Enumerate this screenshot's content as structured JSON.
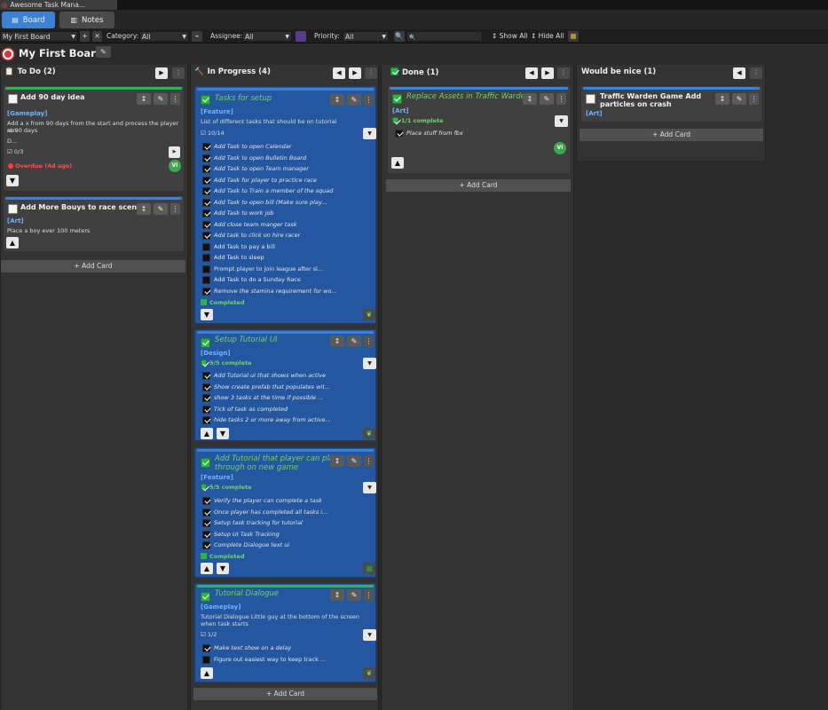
{
  "window": {
    "tab_title": "Awesome Task Mana..."
  },
  "tabs": {
    "board": "Board",
    "notes": "Notes"
  },
  "filters": {
    "board_select": "My First Board",
    "category_label": "Category:",
    "category_value": "All",
    "assignee_label": "Assignee:",
    "assignee_value": "All",
    "priority_label": "Priority:",
    "priority_value": "All",
    "show_all": "Show All",
    "hide_all": "Hide All"
  },
  "board": {
    "title": "My First Board"
  },
  "columns": {
    "todo": {
      "title": "To Do",
      "count": "(2)",
      "add": "+ Add Card"
    },
    "inprogress": {
      "title": "In Progress",
      "count": "(4)",
      "add": "+ Add Card"
    },
    "done": {
      "title": "Done",
      "count": "(1)",
      "add": "+ Add Card"
    },
    "nice": {
      "title": "Would be nice",
      "count": "(1)",
      "add": "+ Add Card"
    }
  },
  "cards": {
    "c1": {
      "title": "Add 90 day idea",
      "tag": "[Gameplay]",
      "desc1": "Add a x from 90 days from the start and process the player run",
      "desc2": "at 90 days",
      "dots": "D...",
      "progress": "☑ 0/3",
      "overdue": "Overdue (4d ago)",
      "avatar": "VI"
    },
    "c2": {
      "title": "Add More Bouys to race scene",
      "tag": "[Art]",
      "desc": "Place a boy ever 100 meters"
    },
    "c3": {
      "title": "Tasks for setup",
      "tag": "[Feature]",
      "desc": "List of different tasks that should be on tutorial",
      "progress": "☑ 10/14",
      "completed": "Completed",
      "subtasks": [
        {
          "text": "Add Task to open Calendar",
          "done": true
        },
        {
          "text": "Add Task to open Bulletin Board",
          "done": true
        },
        {
          "text": "Add Task to open Team manager",
          "done": true
        },
        {
          "text": "Add Task for player to practice race",
          "done": true
        },
        {
          "text": "Add Task to Train a member of the squad",
          "done": true
        },
        {
          "text": "Add Task to open bill (Make sure play...",
          "done": true
        },
        {
          "text": "Add Task to work job",
          "done": true
        },
        {
          "text": "Add close team manger task",
          "done": true
        },
        {
          "text": "Add task to click on hire racer",
          "done": true
        },
        {
          "text": "Add Task to pay a bill",
          "done": false
        },
        {
          "text": "Add Task to sleep",
          "done": false
        },
        {
          "text": "Prompt player to join league after si...",
          "done": false
        },
        {
          "text": "Add Task to do a Sunday Race",
          "done": false
        },
        {
          "text": "Remove the stamina requirement for wo...",
          "done": true
        }
      ]
    },
    "c4": {
      "title": "Setup Tutorial UI",
      "tag": "[Design]",
      "progress": "5/5 complete",
      "subtasks": [
        {
          "text": "Add Tutorial ui that shows when active",
          "done": true
        },
        {
          "text": "Show create prefab that populates wit...",
          "done": true
        },
        {
          "text": "show 3 tasks at the time if possible ...",
          "done": true
        },
        {
          "text": "Tick of task as completed",
          "done": true
        },
        {
          "text": "hide tasks 2 or more away from active...",
          "done": true
        }
      ]
    },
    "c5": {
      "title1": "Add Tutorial that player can play",
      "title2": "through on new game",
      "tag": "[Feature]",
      "progress": "5/5 complete",
      "completed": "Completed",
      "subtasks": [
        {
          "text": "Verify the player can complete a task",
          "done": true
        },
        {
          "text": "Once player has completed all tasks i...",
          "done": true
        },
        {
          "text": "Setup task tracking for tutorial",
          "done": true
        },
        {
          "text": "Setup UI Task Tracking",
          "done": true
        },
        {
          "text": "Complete Dialogue text ui",
          "done": true
        }
      ]
    },
    "c6": {
      "title": "Tutorial Dialogue",
      "tag": "[Gameplay]",
      "desc1": "Tutorial Dialogue Little guy at the bottom of the screen",
      "desc2": "when task starts",
      "progress": "☑ 1/2",
      "subtasks": [
        {
          "text": "Make text show on a delay",
          "done": true
        },
        {
          "text": "Figure out easiest way to keep track ...",
          "done": false
        }
      ]
    },
    "c7": {
      "title": "Replace Assets in Traffic Warden",
      "tag": "[Art]",
      "progress": "1/1 complete",
      "avatar": "VI",
      "subtasks": [
        {
          "text": "Place stuff from fbx",
          "done": true
        }
      ]
    },
    "c8": {
      "title1": "Traffic Warden Game Add",
      "title2": "particles on crash",
      "tag": "[Art]"
    }
  },
  "colors": {
    "accent": "#3b82d6",
    "card_blue": "#2457a0",
    "green_stripe": "#35b34a",
    "overdue": "#ff4d4d"
  }
}
